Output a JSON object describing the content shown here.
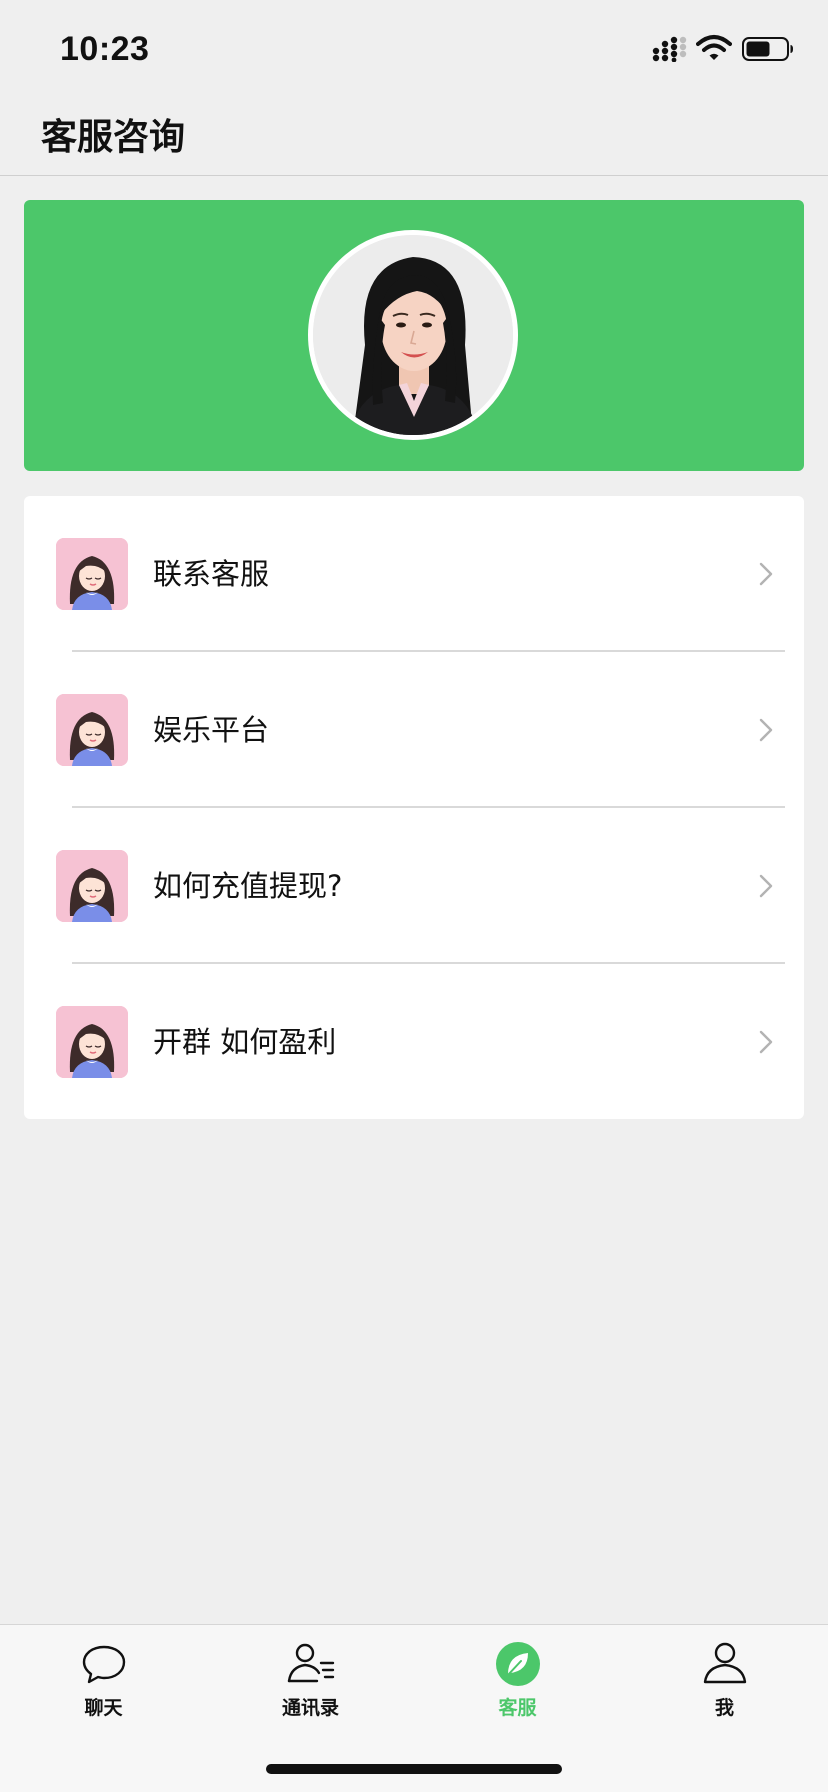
{
  "status_bar": {
    "time": "10:23",
    "icons": [
      "signal-icon",
      "wifi-icon",
      "battery-icon"
    ]
  },
  "header": {
    "title": "客服咨询"
  },
  "banner": {
    "background_color": "#4cc76a",
    "avatar": "profile-photo"
  },
  "menu": {
    "items": [
      {
        "label": "联系客服",
        "icon": "cartoon-avatar-icon"
      },
      {
        "label": "娱乐平台",
        "icon": "cartoon-avatar-icon"
      },
      {
        "label": "如何充值提现?",
        "icon": "cartoon-avatar-icon"
      },
      {
        "label": "开群 如何盈利",
        "icon": "cartoon-avatar-icon"
      }
    ]
  },
  "tab_bar": {
    "tabs": [
      {
        "label": "聊天",
        "icon": "chat-bubble-icon",
        "active": false
      },
      {
        "label": "通讯录",
        "icon": "contacts-icon",
        "active": false
      },
      {
        "label": "客服",
        "icon": "leaf-icon",
        "active": true
      },
      {
        "label": "我",
        "icon": "person-icon",
        "active": false
      }
    ]
  },
  "colors": {
    "accent": "#4cc76a",
    "background": "#efefef",
    "card": "#ffffff",
    "avatar_bg": "#f6c2d3"
  }
}
